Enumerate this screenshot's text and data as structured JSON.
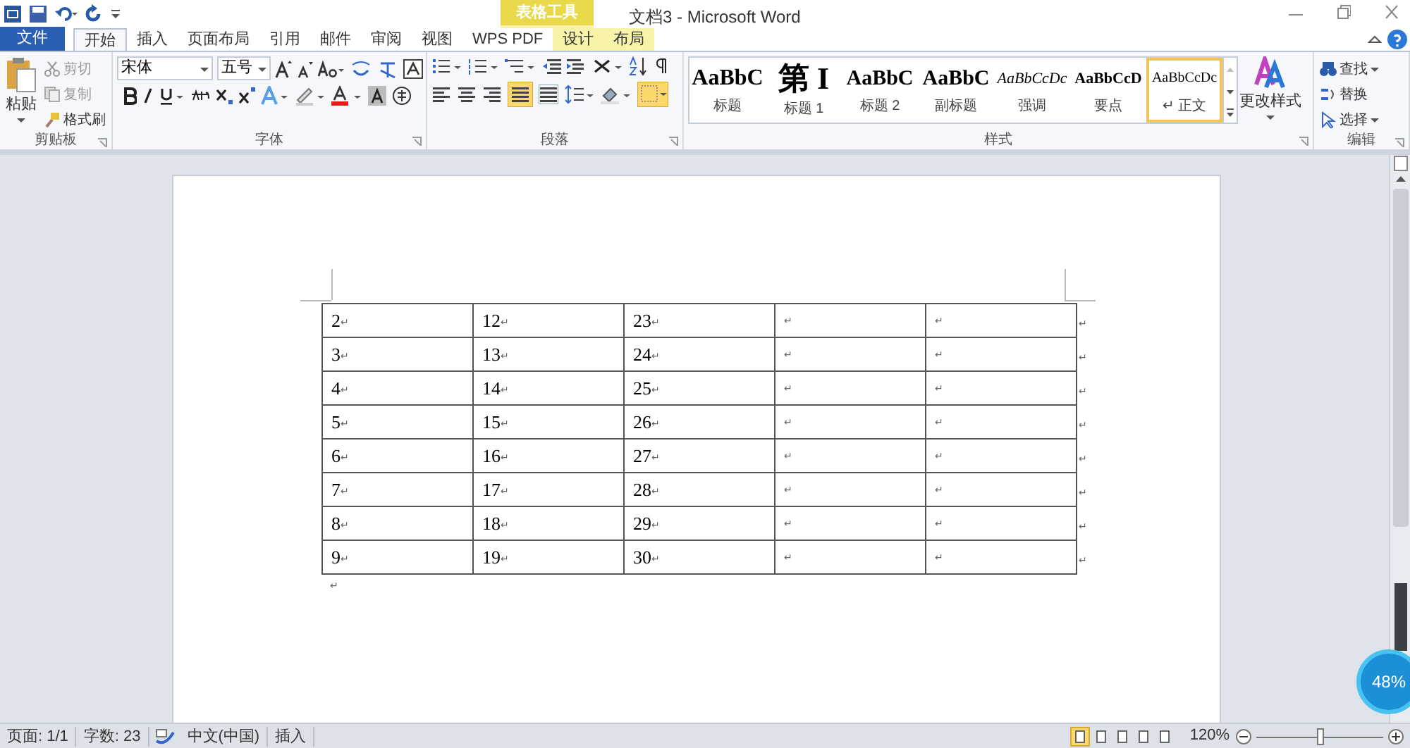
{
  "window": {
    "title": "文档3 - Microsoft Word",
    "context_tab_group": "表格工具"
  },
  "tabs": [
    {
      "label": "文件",
      "kind": "file",
      "selected": false
    },
    {
      "label": "开始",
      "kind": "tab",
      "selected": true
    },
    {
      "label": "插入",
      "kind": "tab",
      "selected": false
    },
    {
      "label": "页面布局",
      "kind": "tab",
      "selected": false
    },
    {
      "label": "引用",
      "kind": "tab",
      "selected": false
    },
    {
      "label": "邮件",
      "kind": "tab",
      "selected": false
    },
    {
      "label": "审阅",
      "kind": "tab",
      "selected": false
    },
    {
      "label": "视图",
      "kind": "tab",
      "selected": false
    },
    {
      "label": "WPS PDF",
      "kind": "tab",
      "selected": false
    },
    {
      "label": "设计",
      "kind": "context",
      "selected": false
    },
    {
      "label": "布局",
      "kind": "context",
      "selected": false
    }
  ],
  "clipboard": {
    "paste": "粘贴",
    "cut": "剪切",
    "copy": "复制",
    "format_painter": "格式刷",
    "label": "剪贴板"
  },
  "font": {
    "name": "宋体",
    "size": "五号",
    "label": "字体"
  },
  "paragraph": {
    "label": "段落",
    "justify_selected": true,
    "borders_selected": true
  },
  "styles": {
    "label": "样式",
    "change": "更改样式",
    "items": [
      {
        "preview": "AaBbC",
        "label": "标题",
        "kind": "title",
        "selected": false
      },
      {
        "preview": "第 I",
        "label": "标题 1",
        "kind": "heading1",
        "selected": false
      },
      {
        "preview": "AaBbC",
        "label": "标题 2",
        "kind": "heading2",
        "selected": false
      },
      {
        "preview": "AaBbC",
        "label": "副标题",
        "kind": "subtitle",
        "selected": false
      },
      {
        "preview": "AaBbCcDc",
        "label": "强调",
        "kind": "emphasis",
        "selected": false
      },
      {
        "preview": "AaBbCcD",
        "label": "要点",
        "kind": "strong",
        "selected": false
      },
      {
        "preview": "AaBbCcDc",
        "label": "↵ 正文",
        "kind": "normal",
        "selected": true
      }
    ]
  },
  "editing": {
    "label": "编辑",
    "find": "查找",
    "replace": "替换",
    "select": "选择"
  },
  "table": {
    "rows": [
      [
        "2",
        "12",
        "23"
      ],
      [
        "3",
        "13",
        "24"
      ],
      [
        "4",
        "14",
        "25"
      ],
      [
        "5",
        "15",
        "26"
      ],
      [
        "6",
        "16",
        "27"
      ],
      [
        "7",
        "17",
        "28"
      ],
      [
        "8",
        "18",
        "29"
      ],
      [
        "9",
        "19",
        "30"
      ]
    ],
    "cell_mark": "↵",
    "row_mark": "↵",
    "after_mark": "↵"
  },
  "status_bar": {
    "page": "页面: 1/1",
    "words": "字数: 23",
    "language": "中文(中国)",
    "mode": "插入",
    "zoom": "120%",
    "zoom_slider": {
      "level": 0.5
    },
    "views": [
      {
        "selected": true
      },
      {
        "selected": false
      },
      {
        "selected": false
      },
      {
        "selected": false
      },
      {
        "selected": false
      }
    ]
  },
  "speed_widget": {
    "reading": "48%"
  }
}
